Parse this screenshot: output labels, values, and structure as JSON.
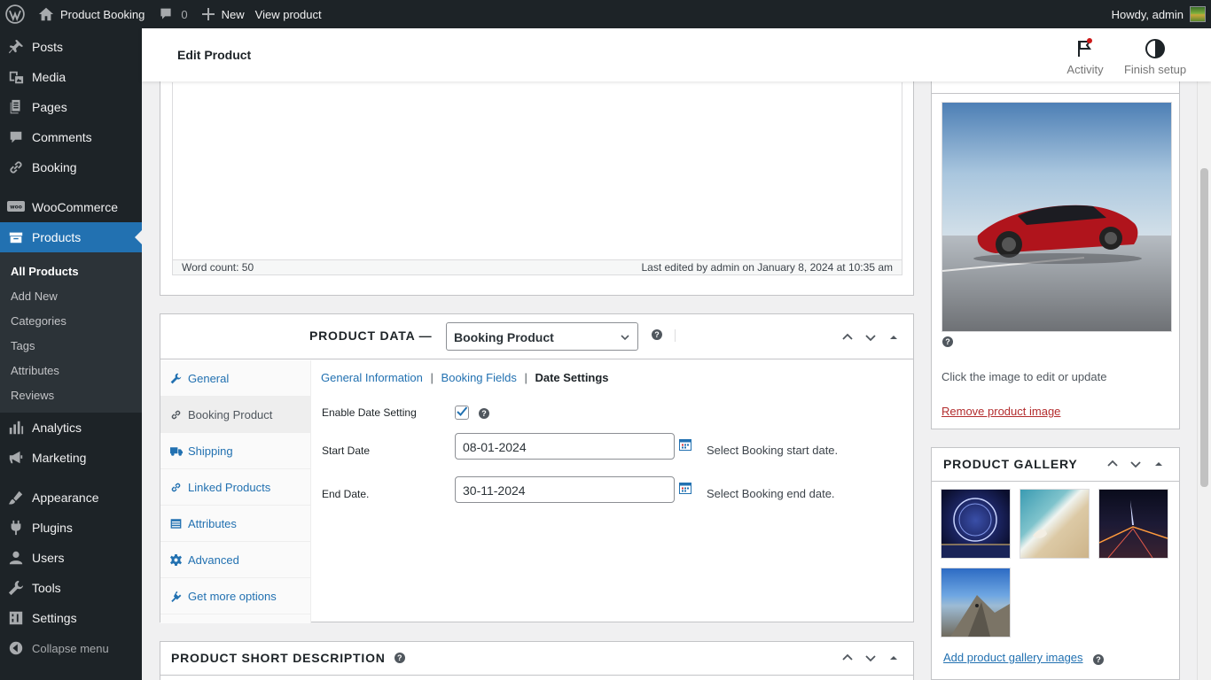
{
  "adminbar": {
    "site_name": "Product Booking",
    "comments_count": "0",
    "new_label": "New",
    "view_product": "View product",
    "howdy": "Howdy, admin"
  },
  "sidebar": {
    "items": [
      {
        "label": "Posts",
        "icon": "pin-icon"
      },
      {
        "label": "Media",
        "icon": "media-icon"
      },
      {
        "label": "Pages",
        "icon": "pages-icon"
      },
      {
        "label": "Comments",
        "icon": "comments-icon"
      },
      {
        "label": "Booking",
        "icon": "link-icon"
      },
      {
        "label": "WooCommerce",
        "icon": "woo-icon"
      },
      {
        "label": "Products",
        "icon": "products-icon"
      },
      {
        "label": "Analytics",
        "icon": "analytics-icon"
      },
      {
        "label": "Marketing",
        "icon": "megaphone-icon"
      },
      {
        "label": "Appearance",
        "icon": "brush-icon"
      },
      {
        "label": "Plugins",
        "icon": "plugin-icon"
      },
      {
        "label": "Users",
        "icon": "users-icon"
      },
      {
        "label": "Tools",
        "icon": "wrench-icon"
      },
      {
        "label": "Settings",
        "icon": "settings-icon"
      }
    ],
    "submenu": [
      "All Products",
      "Add New",
      "Categories",
      "Tags",
      "Attributes",
      "Reviews"
    ],
    "collapse": "Collapse menu"
  },
  "header": {
    "title": "Edit Product",
    "activity": "Activity",
    "finish_setup": "Finish setup"
  },
  "editor": {
    "word_count": "Word count: 50",
    "last_edited": "Last edited by admin on January 8, 2024 at 10:35 am"
  },
  "product_data": {
    "title": "PRODUCT DATA —",
    "type_selected": "Booking Product",
    "tabs": [
      "General",
      "Booking Product",
      "Shipping",
      "Linked Products",
      "Attributes",
      "Advanced",
      "Get more options"
    ],
    "subtabs": {
      "general_info": "General Information",
      "booking_fields": "Booking Fields",
      "date_settings": "Date Settings"
    },
    "enable_date_label": "Enable Date Setting",
    "enable_date_checked": true,
    "start_date_label": "Start Date",
    "start_date_value": "08-01-2024",
    "start_date_desc": "Select Booking start date.",
    "end_date_label": "End Date.",
    "end_date_value": "30-11-2024",
    "end_date_desc": "Select Booking end date."
  },
  "short_description": {
    "title": "PRODUCT SHORT DESCRIPTION"
  },
  "product_image": {
    "hint": "Click the image to edit or update",
    "remove": "Remove product image"
  },
  "gallery": {
    "title": "PRODUCT GALLERY",
    "add": "Add product gallery images"
  },
  "colors": {
    "admin_bar": "#1d2327",
    "accent": "#2271b1",
    "link": "#2271b1",
    "remove_link": "#b32d2e"
  }
}
